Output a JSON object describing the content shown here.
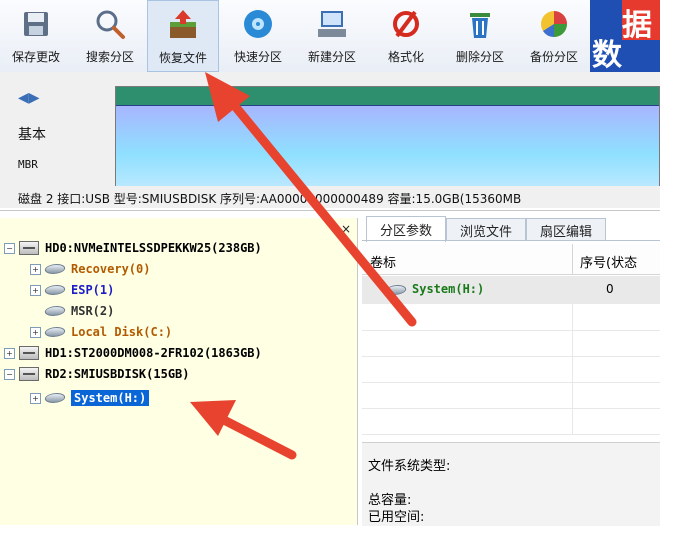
{
  "toolbar": {
    "buttons": [
      {
        "label": "保存更改",
        "icon": "save-icon"
      },
      {
        "label": "搜索分区",
        "icon": "search-icon"
      },
      {
        "label": "恢复文件",
        "icon": "restore-icon"
      },
      {
        "label": "快速分区",
        "icon": "quick-partition-icon"
      },
      {
        "label": "新建分区",
        "icon": "new-partition-icon"
      },
      {
        "label": "格式化",
        "icon": "format-icon"
      },
      {
        "label": "删除分区",
        "icon": "delete-icon"
      },
      {
        "label": "备份分区",
        "icon": "backup-icon"
      }
    ],
    "extra_label": "数",
    "extra_label2": "据"
  },
  "disk_panel": {
    "type_label": "基本",
    "scheme_label": "MBR",
    "info": "磁盘 2 接口:USB  型号:SMIUSBDISK  序列号:AA00000000000489  容量:15.0GB(15360MB"
  },
  "tree": {
    "items": [
      {
        "label": "HD0:NVMeINTELSSDPEKKW25(238GB)",
        "kind": "disk",
        "color": "#000000"
      },
      {
        "label": "Recovery(0)",
        "kind": "partition",
        "color": "#b35a00"
      },
      {
        "label": "ESP(1)",
        "kind": "partition",
        "color": "#1c1cc8"
      },
      {
        "label": "MSR(2)",
        "kind": "partition",
        "color": "#333333"
      },
      {
        "label": "Local Disk(C:)",
        "kind": "partition",
        "color": "#b35a00"
      },
      {
        "label": "HD1:ST2000DM008-2FR102(1863GB)",
        "kind": "disk",
        "color": "#000000"
      },
      {
        "label": "RD2:SMIUSBDISK(15GB)",
        "kind": "disk",
        "color": "#000000"
      },
      {
        "label": "System(H:)",
        "kind": "partition",
        "color": "#ffffff"
      }
    ]
  },
  "right_panel": {
    "tabs": [
      "分区参数",
      "浏览文件",
      "扇区编辑"
    ],
    "col_volume": "卷标",
    "col_index": "序号(状态",
    "row_label": "System(H:)",
    "row_index": "0",
    "fs_type_label": "文件系统类型:",
    "total_label": "总容量:",
    "used_label": "已用空间:"
  },
  "colors": {
    "arrow": "#e8432e",
    "selection": "#0a66d6",
    "tree_bg": "#ffffe4",
    "partition_bar_top": "#3aa07a",
    "partition_bar_fill": "#7fd8ff"
  }
}
